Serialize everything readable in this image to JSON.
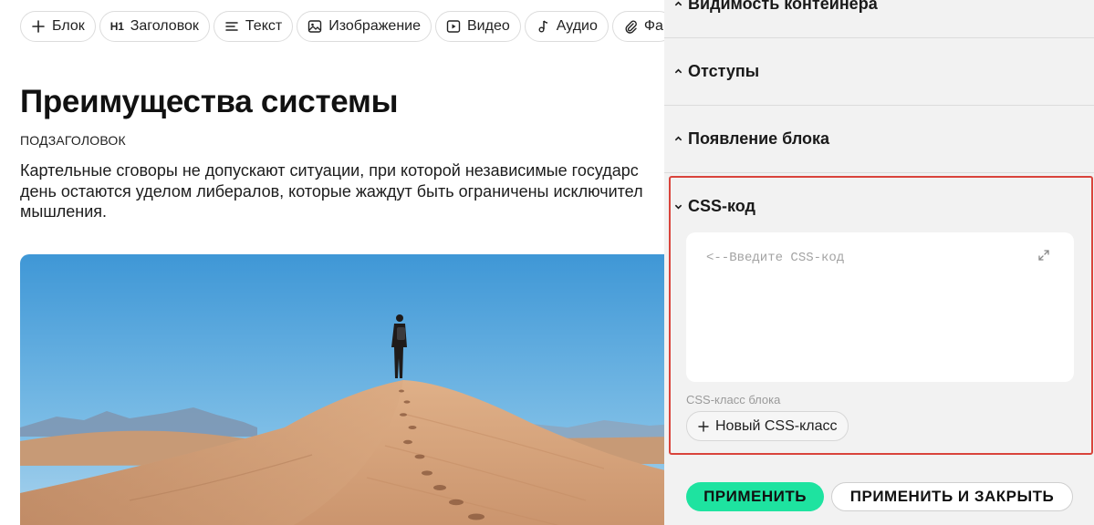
{
  "toolbar": {
    "buttons": [
      {
        "label": "Блок",
        "icon": "plus-icon"
      },
      {
        "label": "Заголовок",
        "icon": "h1-icon",
        "glyph": "H1"
      },
      {
        "label": "Текст",
        "icon": "text-align-icon"
      },
      {
        "label": "Изображение",
        "icon": "image-icon"
      },
      {
        "label": "Видео",
        "icon": "video-icon"
      },
      {
        "label": "Аудио",
        "icon": "music-note-icon"
      },
      {
        "label": "Фа",
        "icon": "paperclip-icon"
      }
    ]
  },
  "content": {
    "title": "Преимущества системы",
    "subtitle": "ПОДЗАГОЛОВОК",
    "lead": "Картельные сговоры не допускают ситуации, при которой независимые государства до сих пор остаются уделом либералов, которые жаждут быть ограничены исключительно образом мышления.",
    "lead_lines": [
      "Картельные сговоры не допускают ситуации, при которой независимые государс",
      "день остаются уделом либералов, которые жаждут быть ограничены исключител",
      "мышления."
    ],
    "image": {
      "subject": "person-on-sand-dune",
      "sky_color": "#5aa7db",
      "sand_color": "#d7a57b"
    }
  },
  "panel": {
    "sections": [
      {
        "label": "Видимость контейнера",
        "expanded": false
      },
      {
        "label": "Отступы",
        "expanded": false
      },
      {
        "label": "Появление блока",
        "expanded": false
      },
      {
        "label": "CSS-код",
        "expanded": true
      }
    ],
    "css_editor": {
      "placeholder": "<--Введите CSS-код"
    },
    "css_class_label": "CSS-класс блока",
    "new_class_button": "Новый CSS-класс",
    "apply_button": "ПРИМЕНИТЬ",
    "apply_close_button": "ПРИМЕНИТЬ И ЗАКРЫТЬ"
  },
  "colors": {
    "accent": "#1ee3a0",
    "highlight_border": "#d9443c",
    "panel_bg": "#f2f2f2"
  }
}
